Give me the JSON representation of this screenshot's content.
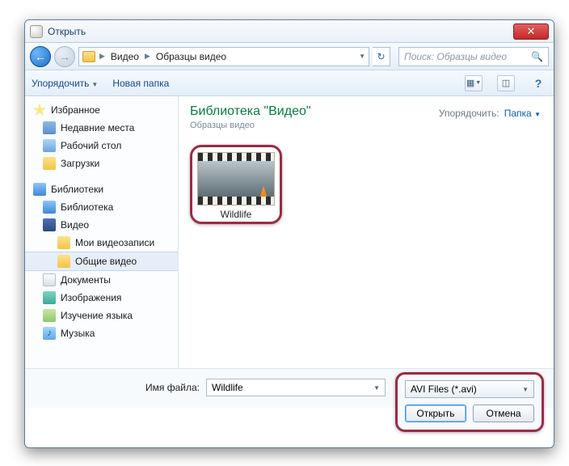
{
  "window": {
    "title": "Открыть"
  },
  "nav": {
    "crumb1": "Видео",
    "crumb2": "Образцы видео",
    "search_placeholder": "Поиск: Образцы видео"
  },
  "toolbar": {
    "organize": "Упорядочить",
    "new_folder": "Новая папка"
  },
  "sidebar": {
    "favorites": "Избранное",
    "recent": "Недавние места",
    "desktop": "Рабочий стол",
    "downloads": "Загрузки",
    "libraries": "Библиотеки",
    "library": "Библиотека",
    "video": "Видео",
    "my_videos": "Мои видеозаписи",
    "public_videos": "Общие видео",
    "documents": "Документы",
    "images": "Изображения",
    "lang_study": "Изучение языка",
    "music": "Музыка"
  },
  "content": {
    "lib_title": "Библиотека \"Видео\"",
    "lib_sub": "Образцы видео",
    "arrange_label": "Упорядочить:",
    "arrange_value": "Папка",
    "file_name": "Wildlife"
  },
  "bottom": {
    "filename_label": "Имя файла:",
    "filename_value": "Wildlife",
    "filter": "AVI Files (*.avi)",
    "open": "Открыть",
    "cancel": "Отмена"
  }
}
